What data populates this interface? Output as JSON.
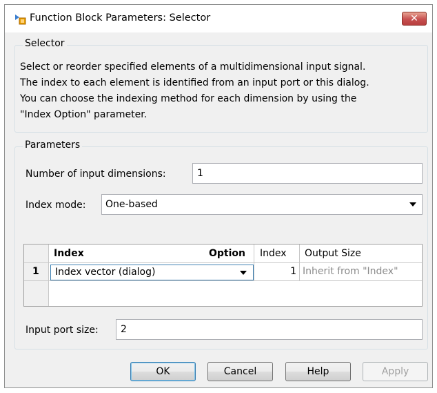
{
  "window": {
    "title": "Function Block Parameters: Selector",
    "close_label": "✕"
  },
  "selector_group": {
    "title": "Selector",
    "description": "Select or reorder specified elements of a multidimensional input signal.\nThe index to each element is identified from an input port or this dialog.\nYou can choose the indexing method for each dimension by using the\n\"Index Option\" parameter."
  },
  "parameters_group": {
    "title": "Parameters",
    "num_dims_label": "Number of input dimensions:",
    "num_dims_value": "1",
    "index_mode_label": "Index mode:",
    "index_mode_value": "One-based",
    "table": {
      "headers": [
        "Index",
        "Option",
        "Index",
        "Output Size"
      ],
      "rows": [
        {
          "row_number": "1",
          "option": "Index vector (dialog)",
          "index": "1",
          "output_size": "Inherit from \"Index\""
        }
      ]
    },
    "input_port_size_label": "Input port size:",
    "input_port_size_value": "2"
  },
  "buttons": {
    "ok": "OK",
    "cancel": "Cancel",
    "help": "Help",
    "apply": "Apply"
  },
  "colors": {
    "dialog_bg": "#f0f0f0",
    "close_button": "#c75050",
    "default_button_border": "#3c7fb1",
    "disabled_text": "#a0a0a0"
  },
  "icons": {
    "title": "simulink-block-icon",
    "close": "close-icon",
    "dropdown": "chevron-down-icon"
  }
}
